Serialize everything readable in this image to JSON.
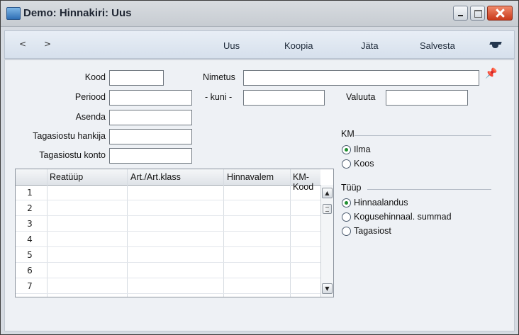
{
  "window": {
    "title": "Demo: Hinnakiri: Uus",
    "buttons": [
      "minimize",
      "maximize",
      "close"
    ]
  },
  "toolbar": {
    "prev_label": "<",
    "next_label": ">",
    "items": [
      "Uus",
      "Koopia",
      "Jäta",
      "Salvesta"
    ],
    "help_icon": "graduation-cap-icon"
  },
  "form": {
    "kood_label": "Kood",
    "kood_value": "",
    "nimetus_label": "Nimetus",
    "nimetus_value": "",
    "periood_label": "Periood",
    "periood_value": "",
    "kuni_label": "- kuni -",
    "kuni_value": "",
    "valuuta_label": "Valuuta",
    "valuuta_value": "",
    "asenda_label": "Asenda",
    "asenda_value": "",
    "hankija_label": "Tagasiostu hankija",
    "hankija_value": "",
    "konto_label": "Tagasiostu konto",
    "konto_value": "",
    "pin_icon": "pushpin-icon"
  },
  "table": {
    "columns": [
      "",
      "Reatüüp",
      "Art./Art.klass",
      "Hinnavalem",
      "KM-Kood"
    ],
    "rows": [
      "1",
      "2",
      "3",
      "4",
      "5",
      "6",
      "7"
    ]
  },
  "km": {
    "title": "KM",
    "options": [
      "Ilma",
      "Koos"
    ],
    "selected": "Ilma"
  },
  "tyyp": {
    "title": "Tüüp",
    "options": [
      "Hinnaalandus",
      "Kogusehinnaal. summad",
      "Tagasiost"
    ],
    "selected": "Hinnaalandus"
  }
}
